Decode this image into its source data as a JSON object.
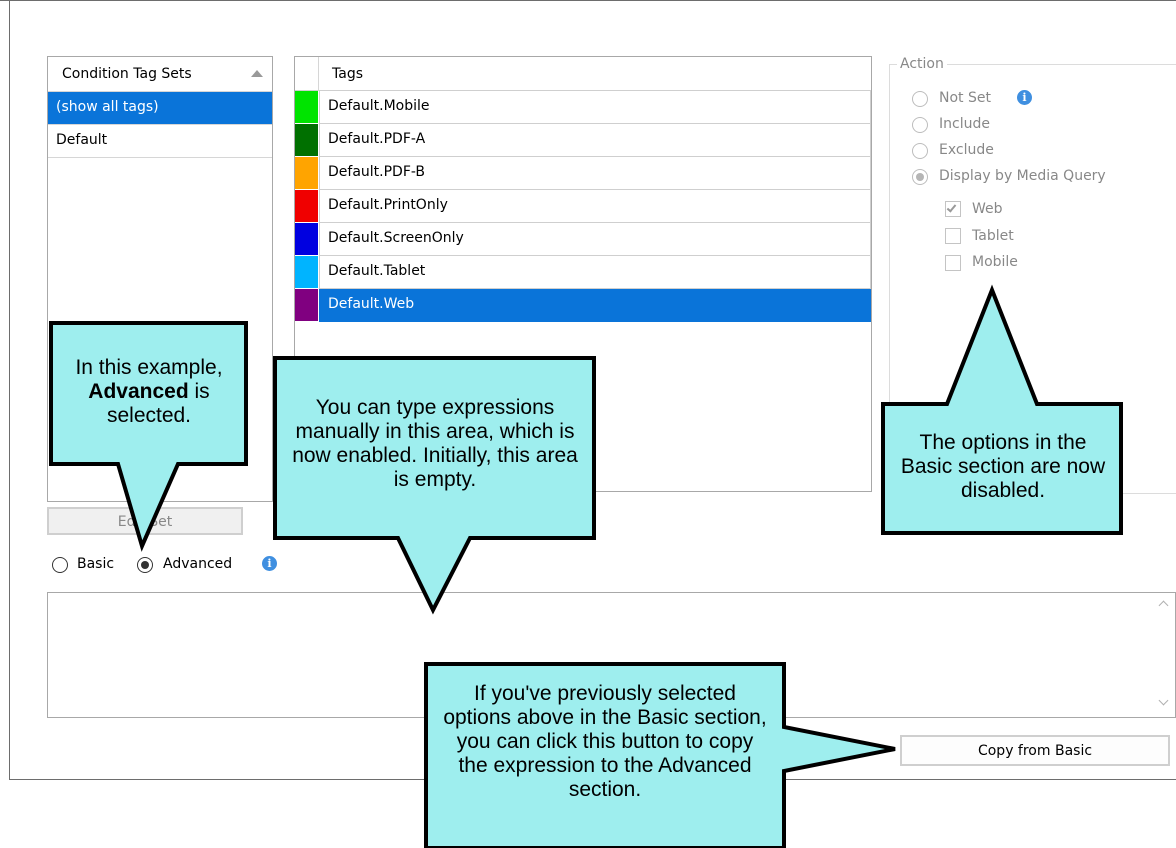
{
  "tag_sets": {
    "header": "Condition Tag Sets",
    "items": [
      "(show all tags)",
      "Default"
    ],
    "selected_index": 0
  },
  "tags": {
    "header": "Tags",
    "items": [
      {
        "label": "Default.Mobile",
        "color": "#00e400"
      },
      {
        "label": "Default.PDF-A",
        "color": "#007000"
      },
      {
        "label": "Default.PDF-B",
        "color": "#ffa400"
      },
      {
        "label": "Default.PrintOnly",
        "color": "#f00000"
      },
      {
        "label": "Default.ScreenOnly",
        "color": "#0000e0"
      },
      {
        "label": "Default.Tablet",
        "color": "#00b4ff"
      },
      {
        "label": "Default.Web",
        "color": "#800080"
      }
    ],
    "selected_index": 6
  },
  "action": {
    "legend": "Action",
    "options": [
      "Not Set",
      "Include",
      "Exclude",
      "Display by Media Query"
    ],
    "selected": "Display by Media Query",
    "media": [
      {
        "label": "Web",
        "checked": true
      },
      {
        "label": "Tablet",
        "checked": false
      },
      {
        "label": "Mobile",
        "checked": false
      }
    ]
  },
  "edit_set_button": "Edit Set",
  "mode": {
    "basic_label": "Basic",
    "advanced_label": "Advanced",
    "selected": "Advanced"
  },
  "expression_text": "",
  "copy_button": "Copy from Basic",
  "callouts": {
    "advanced": [
      "In this example,",
      "Advanced",
      "is",
      "selected."
    ],
    "expressions": "You can type expressions manually in this area, which is now enabled. Initially, this area is empty.",
    "basic_disabled": "The options in the Basic section are now disabled.",
    "copy": "If you've previously selected options above in the Basic section, you can click this button to copy the expression to the Advanced section."
  },
  "colors": {
    "selection": "#0a74d9",
    "callout_fill": "#9eeeee",
    "info_icon": "#3f8fe0"
  }
}
